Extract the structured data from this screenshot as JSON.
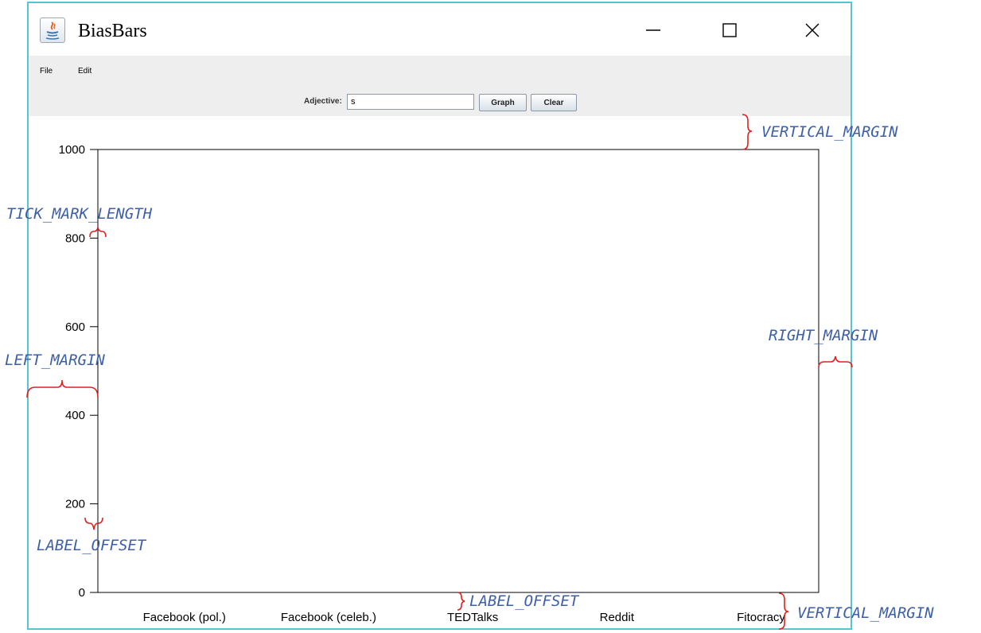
{
  "window": {
    "title": "BiasBars",
    "icon": "java-icon"
  },
  "window_controls": {
    "minimize": "minimize-icon",
    "maximize": "maximize-icon",
    "close": "close-icon"
  },
  "menu": {
    "file": "File",
    "edit": "Edit"
  },
  "toolbar": {
    "adjective_label": "Adjective:",
    "adjective_value": "s",
    "graph_label": "Graph",
    "clear_label": "Clear"
  },
  "chart_data": {
    "type": "bar",
    "categories": [
      "Facebook (pol.)",
      "Facebook (celeb.)",
      "TEDTalks",
      "Reddit",
      "Fitocracy"
    ],
    "series": [],
    "yticks": [
      0,
      200,
      400,
      600,
      800,
      1000
    ],
    "ylim": [
      0,
      1000
    ],
    "title": "",
    "xlabel": "",
    "ylabel": ""
  },
  "annotations": {
    "vertical_margin_top": "VERTICAL_MARGIN",
    "tick_mark_length": "TICK_MARK_LENGTH",
    "left_margin": "LEFT_MARGIN",
    "right_margin": "RIGHT_MARGIN",
    "label_offset_left": "LABEL_OFFSET",
    "label_offset_bottom": "LABEL_OFFSET",
    "vertical_margin_bottom": "VERTICAL_MARGIN"
  },
  "colors": {
    "annotation_text": "#3d5fa8",
    "brace": "#e02020",
    "window_border": "#5bc3cf",
    "panel_bg": "#eeeeee"
  }
}
